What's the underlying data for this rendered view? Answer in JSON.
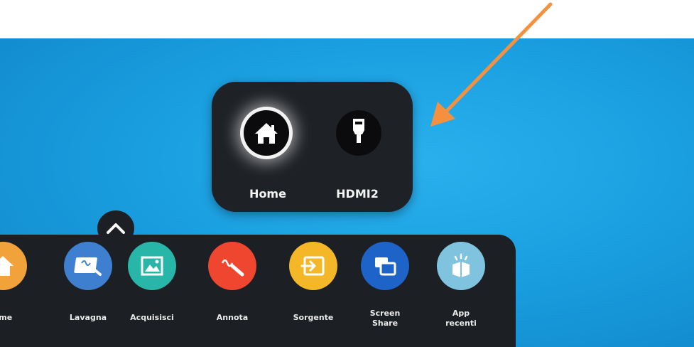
{
  "colors": {
    "screen_bg": "#1a9fe0",
    "popup_bg": "#1e2126",
    "arrow": "#f5913e",
    "tray_bg": "#1c1f24"
  },
  "source_popup": {
    "items": [
      {
        "label": "Home",
        "icon": "home-icon",
        "selected": true
      },
      {
        "label": "HDMI2",
        "icon": "hdmi-plug-icon",
        "selected": false
      }
    ]
  },
  "tray": {
    "handle_icon": "chevron-up-icon",
    "items": [
      {
        "label": "ome",
        "icon": "home-icon",
        "color": "#f2a23a"
      },
      {
        "label": "Lavagna",
        "icon": "whiteboard-icon",
        "color": "#3f7fd0"
      },
      {
        "label": "Acquisisci",
        "icon": "capture-icon",
        "color": "#27b6a8"
      },
      {
        "label": "Annota",
        "icon": "annotate-icon",
        "color": "#ef4630"
      },
      {
        "label": "Sorgente",
        "icon": "input-source-icon",
        "color": "#f4b728"
      },
      {
        "label_line1": "Screen",
        "label_line2": "Share",
        "icon": "screen-share-icon",
        "color": "#1e63c8"
      },
      {
        "label_line1": "App",
        "label_line2": "recenti",
        "icon": "recent-apps-icon",
        "color": "#7fc3de"
      }
    ]
  }
}
